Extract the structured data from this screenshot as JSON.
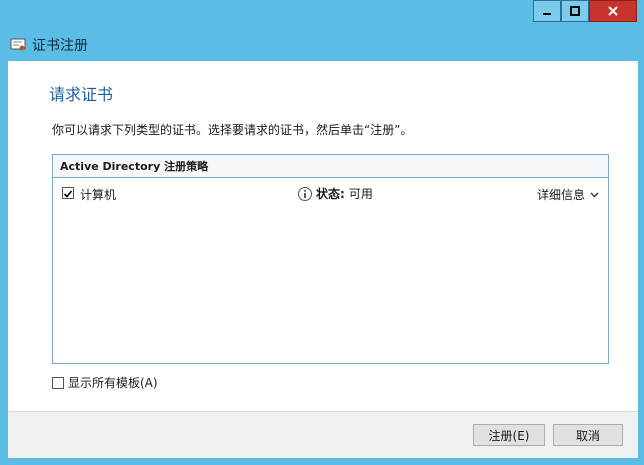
{
  "window": {
    "title": "证书注册"
  },
  "page": {
    "heading": "请求证书",
    "description": "你可以请求下列类型的证书。选择要请求的证书，然后单击“注册”。"
  },
  "policy": {
    "title": "Active Directory 注册策略",
    "items": [
      {
        "label": "计算机",
        "checked": true,
        "status_label": "状态:",
        "status_value": "可用",
        "details_label": "详细信息"
      }
    ]
  },
  "show_all_templates": {
    "label": "显示所有模板(A)",
    "checked": false
  },
  "buttons": {
    "enroll": "注册(E)",
    "cancel": "取消"
  },
  "colors": {
    "title_bar": "#5bbde6",
    "heading": "#1e5f9e",
    "close_button": "#c7342c"
  }
}
